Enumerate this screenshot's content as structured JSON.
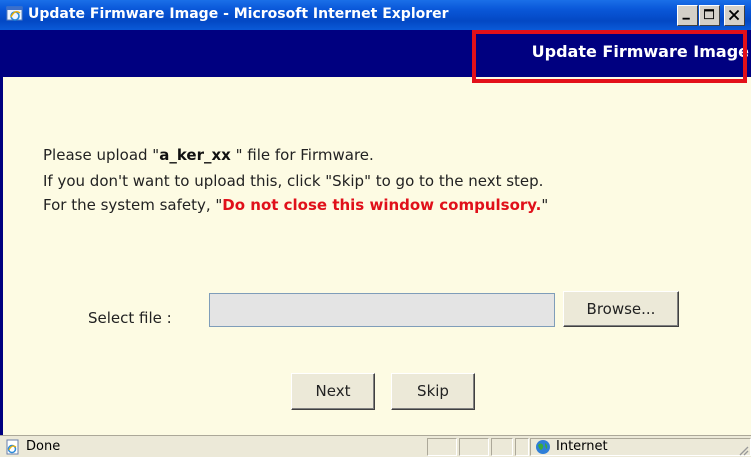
{
  "window": {
    "title": "Update Firmware Image - Microsoft Internet Explorer",
    "controls": [
      "minimize",
      "maximize",
      "close"
    ]
  },
  "header": {
    "title": "Update Firmware Image"
  },
  "content": {
    "line1_prefix": "Please upload \"",
    "line1_file": "a_ker_xx",
    "line1_suffix": " \" file for Firmware.",
    "line2": "If you don't want to upload this, click \"Skip\" to go to the next step.",
    "line3_prefix": "For the system safety, \"",
    "line3_warning": "Do not close this window compulsory.",
    "line3_suffix": "\""
  },
  "form": {
    "select_label": "Select file :",
    "file_value": "",
    "browse_label": "Browse...",
    "next_label": "Next",
    "skip_label": "Skip"
  },
  "statusbar": {
    "status": "Done",
    "zone": "Internet"
  },
  "colors": {
    "header_bg": "#000080",
    "content_bg": "#fdfbe3",
    "warning": "#e0101a",
    "highlight": "#e31019"
  }
}
